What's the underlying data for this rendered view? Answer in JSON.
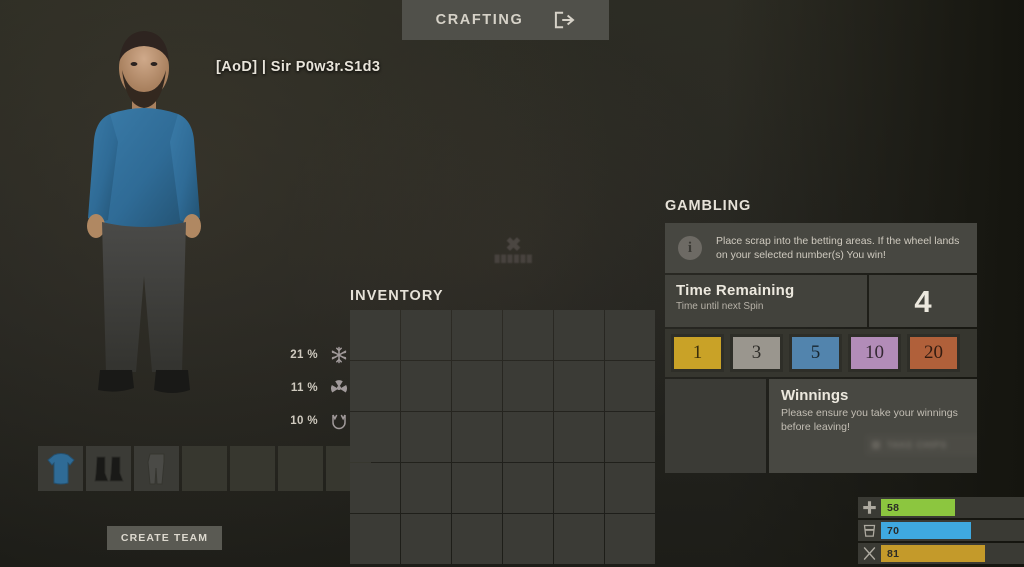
{
  "window": {
    "background_color": "#272720"
  },
  "tabbar": {
    "crafting_label": "CRAFTING",
    "exit_icon": "exit-arrow-icon"
  },
  "character": {
    "player_name": "[AoD] | Sir P0w3r.S1d3",
    "shirt_color": "#2f6b96"
  },
  "protection": {
    "rows": [
      {
        "value": "21 %",
        "icon": "snowflake-icon",
        "label": "cold-protection"
      },
      {
        "value": "11 %",
        "icon": "radiation-icon",
        "label": "radiation-protection"
      },
      {
        "value": "10 %",
        "icon": "bite-icon",
        "label": "bite-protection"
      }
    ]
  },
  "belt": {
    "slots": [
      {
        "item": "blue-shirt",
        "empty": false
      },
      {
        "item": "black-boots",
        "empty": false
      },
      {
        "item": "grey-pants",
        "empty": false
      },
      {
        "item": "",
        "empty": true
      },
      {
        "item": "",
        "empty": true
      },
      {
        "item": "",
        "empty": true
      },
      {
        "item": "",
        "empty": true
      }
    ]
  },
  "create_team": {
    "label": "CREATE TEAM"
  },
  "inventory": {
    "title": "INVENTORY",
    "columns": 6,
    "rows": 5,
    "slots": [
      "",
      "",
      "",
      "",
      "",
      "",
      "",
      "",
      "",
      "",
      "",
      "",
      "",
      "",
      "",
      "",
      "",
      "",
      "",
      "",
      "",
      "",
      "",
      "",
      "",
      "",
      "",
      "",
      "",
      ""
    ]
  },
  "gambling": {
    "title": "GAMBLING",
    "info": {
      "icon": "info-icon",
      "text": "Place scrap into the betting areas. If the wheel lands on your selected number(s) You win!"
    },
    "timer": {
      "title": "Time Remaining",
      "subtitle": "Time until next Spin",
      "value": "4"
    },
    "bets": [
      {
        "number": "1",
        "color": "#c9a227"
      },
      {
        "number": "3",
        "color": "#9a968e"
      },
      {
        "number": "5",
        "color": "#5284ad"
      },
      {
        "number": "10",
        "color": "#b28cb8"
      },
      {
        "number": "20",
        "color": "#b0603a"
      }
    ],
    "winnings": {
      "title": "Winnings",
      "subtitle": "Please ensure you take your winnings before leaving!",
      "ghost_button_label": "TAKE CHIPS"
    }
  },
  "vitals": [
    {
      "icon": "health-cross-icon",
      "value": "58",
      "color": "#8cc63f",
      "width_pct": 58
    },
    {
      "icon": "water-cup-icon",
      "value": "70",
      "color": "#3fa9e0",
      "width_pct": 70
    },
    {
      "icon": "food-utensils-icon",
      "value": "81",
      "color": "#c49a2a",
      "width_pct": 81
    }
  ]
}
